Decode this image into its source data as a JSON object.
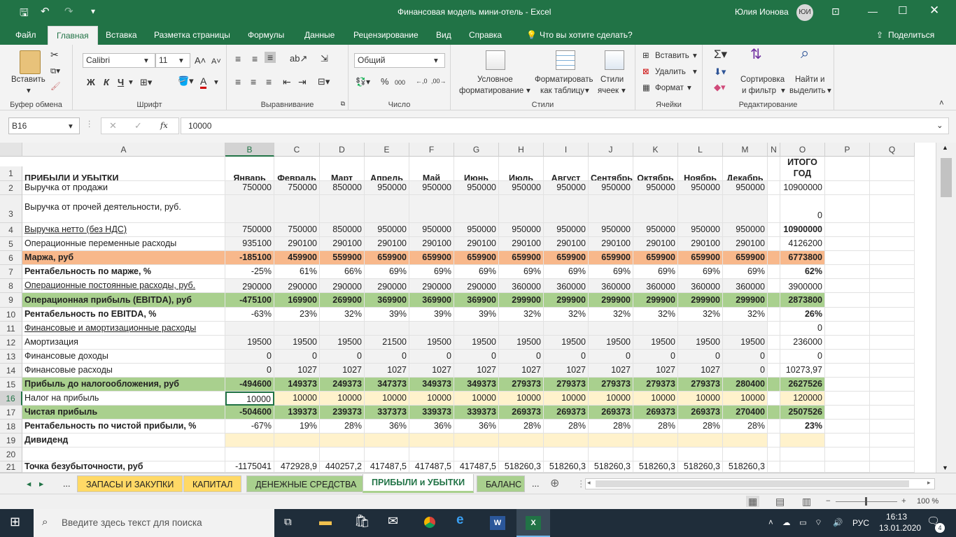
{
  "title": {
    "doc": "Финансовая модель мини-отель - Excel",
    "user": "Юлия Ионова",
    "initials": "ЮИ"
  },
  "tabs": [
    "Файл",
    "Главная",
    "Вставка",
    "Разметка страницы",
    "Формулы",
    "Данные",
    "Рецензирование",
    "Вид",
    "Справка",
    "Что вы хотите сделать?"
  ],
  "share": "Поделиться",
  "ribbon": {
    "paste": "Вставить",
    "clipboard": "Буфер обмена",
    "font_name": "Calibri",
    "font_size": "11",
    "font_group": "Шрифт",
    "bold": "Ж",
    "italic": "К",
    "underline": "Ч",
    "alignment": "Выравнивание",
    "number_format": "Общий",
    "number": "Число",
    "cond_format": [
      "Условное",
      "форматирование"
    ],
    "format_table": [
      "Форматировать",
      "как таблицу"
    ],
    "cell_styles": [
      "Стили",
      "ячеек"
    ],
    "styles": "Стили",
    "insert": "Вставить",
    "delete": "Удалить",
    "format": "Формат",
    "cells": "Ячейки",
    "sort": [
      "Сортировка",
      "и фильтр"
    ],
    "find": [
      "Найти и",
      "выделить"
    ],
    "editing": "Редактирование"
  },
  "formula": {
    "namebox": "B16",
    "value": "10000"
  },
  "columns": [
    "A",
    "B",
    "C",
    "D",
    "E",
    "F",
    "G",
    "H",
    "I",
    "J",
    "K",
    "L",
    "M",
    "N",
    "O",
    "P",
    "Q"
  ],
  "header_row": {
    "a": "ПРИБЫЛИ И УБЫТКИ",
    "months": [
      "Январь",
      "Февраль",
      "Март",
      "Апрель",
      "Май",
      "Июнь",
      "Июль",
      "Август",
      "Сентябрь",
      "Октябрь",
      "Ноябрь",
      "Декабрь"
    ],
    "total": [
      "ИТОГО",
      "ГОД"
    ]
  },
  "rows": [
    {
      "n": "2",
      "label": "Выручка от продажи",
      "vals": [
        "750000",
        "750000",
        "850000",
        "950000",
        "950000",
        "950000",
        "950000",
        "950000",
        "950000",
        "950000",
        "950000",
        "950000"
      ],
      "total": "10900000"
    },
    {
      "n": "3",
      "label": "Выручка от прочей деятельности, руб.",
      "vals": [],
      "total": "0"
    },
    {
      "n": "4",
      "label": "Выручка нетто (без НДС)",
      "vals": [
        "750000",
        "750000",
        "850000",
        "950000",
        "950000",
        "950000",
        "950000",
        "950000",
        "950000",
        "950000",
        "950000",
        "950000"
      ],
      "total": "10900000"
    },
    {
      "n": "5",
      "label": "Операционные переменные расходы",
      "vals": [
        "935100",
        "290100",
        "290100",
        "290100",
        "290100",
        "290100",
        "290100",
        "290100",
        "290100",
        "290100",
        "290100",
        "290100"
      ],
      "total": "4126200"
    },
    {
      "n": "6",
      "label": "Маржа, руб",
      "vals": [
        "-185100",
        "459900",
        "559900",
        "659900",
        "659900",
        "659900",
        "659900",
        "659900",
        "659900",
        "659900",
        "659900",
        "659900"
      ],
      "total": "6773800"
    },
    {
      "n": "7",
      "label": "Рентабельность по марже, %",
      "vals": [
        "-25%",
        "61%",
        "66%",
        "69%",
        "69%",
        "69%",
        "69%",
        "69%",
        "69%",
        "69%",
        "69%",
        "69%"
      ],
      "total": "62%"
    },
    {
      "n": "8",
      "label": "Операционные постоянные расходы, руб.",
      "vals": [
        "290000",
        "290000",
        "290000",
        "290000",
        "290000",
        "290000",
        "360000",
        "360000",
        "360000",
        "360000",
        "360000",
        "360000"
      ],
      "total": "3900000"
    },
    {
      "n": "9",
      "label": "Операционная прибыль (EBITDA), руб",
      "vals": [
        "-475100",
        "169900",
        "269900",
        "369900",
        "369900",
        "369900",
        "299900",
        "299900",
        "299900",
        "299900",
        "299900",
        "299900"
      ],
      "total": "2873800"
    },
    {
      "n": "10",
      "label": "Рентабельность по EBITDA, %",
      "vals": [
        "-63%",
        "23%",
        "32%",
        "39%",
        "39%",
        "39%",
        "32%",
        "32%",
        "32%",
        "32%",
        "32%",
        "32%"
      ],
      "total": "26%"
    },
    {
      "n": "11",
      "label": "Финансовые и амортизационные расходы",
      "vals": [],
      "total": "0"
    },
    {
      "n": "12",
      "label": "Амортизация",
      "vals": [
        "19500",
        "19500",
        "19500",
        "21500",
        "19500",
        "19500",
        "19500",
        "19500",
        "19500",
        "19500",
        "19500",
        "19500"
      ],
      "total": "236000"
    },
    {
      "n": "13",
      "label": "Финансовые доходы",
      "vals": [
        "0",
        "0",
        "0",
        "0",
        "0",
        "0",
        "0",
        "0",
        "0",
        "0",
        "0",
        "0"
      ],
      "total": "0"
    },
    {
      "n": "14",
      "label": "Финансовые расходы",
      "vals": [
        "0",
        "1027",
        "1027",
        "1027",
        "1027",
        "1027",
        "1027",
        "1027",
        "1027",
        "1027",
        "1027",
        "0"
      ],
      "total": "10273,97"
    },
    {
      "n": "15",
      "label": "Прибыль до налогообложения, руб",
      "vals": [
        "-494600",
        "149373",
        "249373",
        "347373",
        "349373",
        "349373",
        "279373",
        "279373",
        "279373",
        "279373",
        "279373",
        "280400"
      ],
      "total": "2627526"
    },
    {
      "n": "16",
      "label": "Налог на прибыль",
      "vals": [
        "10000",
        "10000",
        "10000",
        "10000",
        "10000",
        "10000",
        "10000",
        "10000",
        "10000",
        "10000",
        "10000",
        "10000"
      ],
      "total": "120000"
    },
    {
      "n": "17",
      "label": "Чистая прибыль",
      "vals": [
        "-504600",
        "139373",
        "239373",
        "337373",
        "339373",
        "339373",
        "269373",
        "269373",
        "269373",
        "269373",
        "269373",
        "270400"
      ],
      "total": "2507526"
    },
    {
      "n": "18",
      "label": "Рентабельность по чистой прибыли, %",
      "vals": [
        "-67%",
        "19%",
        "28%",
        "36%",
        "36%",
        "36%",
        "28%",
        "28%",
        "28%",
        "28%",
        "28%",
        "28%"
      ],
      "total": "23%"
    },
    {
      "n": "19",
      "label": "Дивиденд",
      "vals": [],
      "total": ""
    },
    {
      "n": "20",
      "label": "",
      "vals": [],
      "total": ""
    },
    {
      "n": "21",
      "label": "Точка безубыточности, руб",
      "vals": [
        "-1175041",
        "472928,9",
        "440257,2",
        "417487,5",
        "417487,5",
        "417487,5",
        "518260,3",
        "518260,3",
        "518260,3",
        "518260,3",
        "518260,3",
        "518260,3"
      ],
      "total": ""
    }
  ],
  "sheets": [
    "ЗАПАСЫ И ЗАКУПКИ",
    "КАПИТАЛ",
    "ДЕНЕЖНЫЕ СРЕДСТВА",
    "ПРИБЫЛИ и УБЫТКИ",
    "БАЛАНС"
  ],
  "zoom": "100 %",
  "taskbar": {
    "search": "Введите здесь текст для поиска",
    "lang": "РУС",
    "time": "16:13",
    "date": "13.01.2020",
    "notif": "4"
  },
  "colors": {
    "excel_green": "#217346",
    "orange": "#f8b88b",
    "green_row": "#a9d08e",
    "light_yellow": "#fff2cc",
    "gray_row": "#f2f2f2"
  }
}
